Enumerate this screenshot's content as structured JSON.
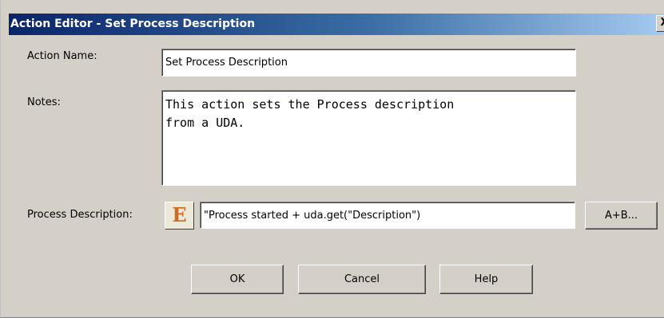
{
  "window": {
    "title": "Action Editor - Set Process Description",
    "close_glyph": "X"
  },
  "form": {
    "action_name_label": "Action Name:",
    "action_name_value": "Set Process Description",
    "notes_label": "Notes:",
    "notes_value": "This action sets the Process description\nfrom a UDA.",
    "process_description_label": "Process Description:",
    "expression_icon_glyph": "E",
    "process_description_value": "\"Process started + uda.get(\"Description\")",
    "builder_button_label": "A+B..."
  },
  "buttons": {
    "ok": "OK",
    "cancel": "Cancel",
    "help": "Help"
  },
  "colors": {
    "dialog_bg": "#d4d0c8",
    "titlebar_start": "#0a246a",
    "titlebar_end": "#a6caf0",
    "expression_icon": "#d2691e"
  },
  "icons": {
    "close": "close-icon",
    "expression": "expression-editor-icon"
  }
}
